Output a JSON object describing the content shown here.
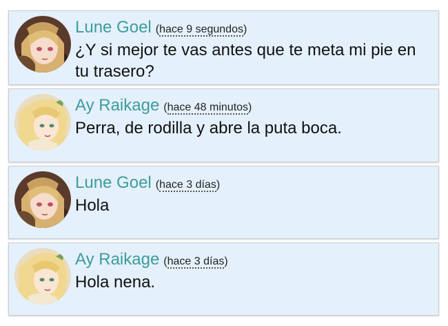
{
  "messages": [
    {
      "author": "Lune Goel",
      "time_open": "(",
      "time": "hace 9 segundos",
      "time_close": ")",
      "text": "¿Y si mejor te vas antes que te meta mi pie en tu trasero?",
      "avatar": "lune-avatar"
    },
    {
      "author": "Ay Raikage",
      "time_open": "(",
      "time": "hace 48 minutos",
      "time_close": ")",
      "text": "Perra, de rodilla y abre la puta boca.",
      "avatar": "raikage-avatar"
    },
    {
      "author": "Lune Goel",
      "time_open": "(",
      "time": "hace 3 días",
      "time_close": ")",
      "text": "Hola",
      "avatar": "lune-avatar"
    },
    {
      "author": "Ay Raikage",
      "time_open": "(",
      "time": "hace 3 días",
      "time_close": ")",
      "text": "Hola nena.",
      "avatar": "raikage-avatar"
    }
  ],
  "colors": {
    "card_bg": "#e4f0fb",
    "author_name": "#3e9c9c",
    "message_text": "#111111"
  }
}
